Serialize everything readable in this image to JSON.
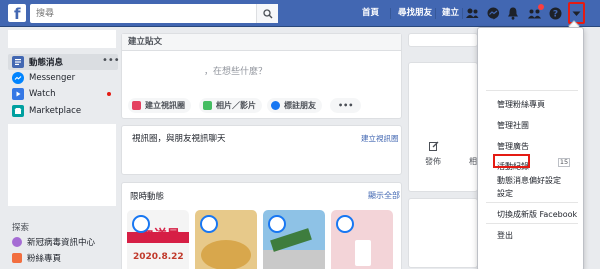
{
  "topbar": {
    "logo": "f",
    "search_placeholder": "搜尋",
    "home_label": "首頁",
    "find_friends_label": "尋找朋友",
    "create_label": "建立"
  },
  "left_nav": {
    "items": [
      {
        "label": "動態消息",
        "icon": "news-feed-icon"
      },
      {
        "label": "Messenger",
        "icon": "messenger-icon"
      },
      {
        "label": "Watch",
        "icon": "watch-icon"
      },
      {
        "label": "Marketplace",
        "icon": "marketplace-icon"
      }
    ],
    "explore_title": "探索",
    "explore_items": [
      {
        "label": "新冠病毒資訊中心",
        "icon": "covid-info-icon"
      },
      {
        "label": "粉絲專頁",
        "icon": "pages-flag-icon"
      }
    ]
  },
  "composer": {
    "header": "建立貼文",
    "placeholder": "，在想些什麼？",
    "actions": [
      {
        "label": "建立視訊圈",
        "color": "#e4405f"
      },
      {
        "label": "相片／影片",
        "color": "#45bd62"
      },
      {
        "label": "標註朋友",
        "color": "#1877f2"
      }
    ],
    "more": "•••"
  },
  "room": {
    "title": "視訊圈，與朋友視訊聊天",
    "link": "建立視訊圈"
  },
  "stories": {
    "title": "限時動態",
    "link": "顯示全部",
    "cards": [
      {
        "text": "血送暑",
        "sub": "2020.8.22",
        "bg": "#f4f4f4"
      },
      {
        "text": "",
        "sub": "",
        "bg": "#e7c98a"
      },
      {
        "text": "",
        "sub": "",
        "bg": "#8ec2e6"
      },
      {
        "text": "",
        "sub": "",
        "bg": "#f3d4d8"
      }
    ]
  },
  "right_partial": {
    "label1": "發佈",
    "label2": "相"
  },
  "menu": {
    "items": [
      {
        "label": "管理粉絲專頁"
      },
      {
        "label": "管理社團"
      },
      {
        "label": "管理廣告"
      },
      {
        "label": "活動紀錄",
        "badge": "15"
      },
      {
        "label": "動態消息偏好設定"
      },
      {
        "label": "設定"
      },
      {
        "label": "切換成新版 Facebook"
      },
      {
        "label": "登出"
      }
    ]
  },
  "colors": {
    "brand": "#4267b2",
    "highlight": "#e41b13"
  }
}
